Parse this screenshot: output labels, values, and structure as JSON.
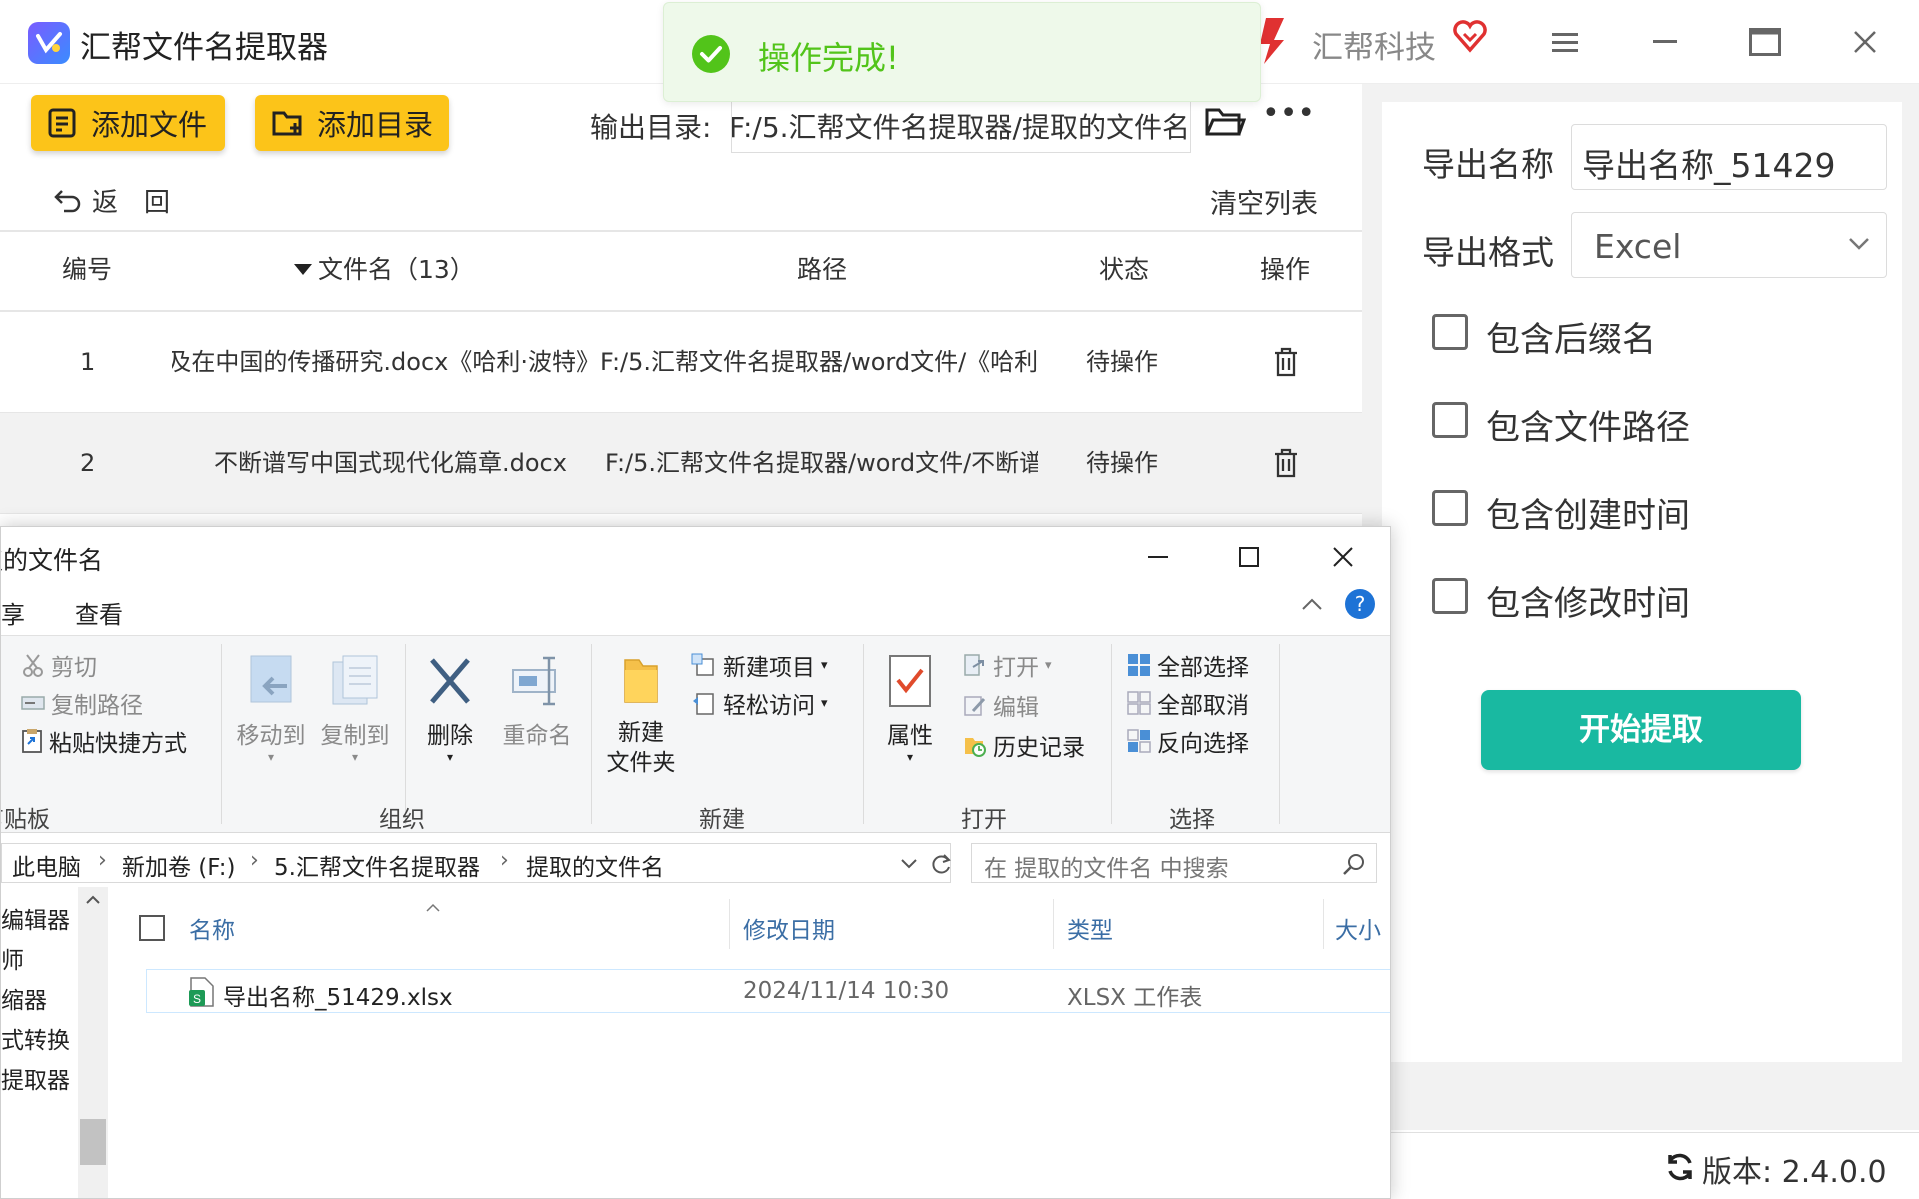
{
  "app": {
    "title": "汇帮文件名提取器",
    "brand": "汇帮科技"
  },
  "toast": {
    "message": "操作完成!"
  },
  "toolbar": {
    "add_file": "添加文件",
    "add_dir": "添加目录",
    "output_label": "输出目录:",
    "output_path": "F:/5.汇帮文件名提取器/提取的文件名",
    "more": "•••"
  },
  "nav": {
    "back": "返　回",
    "clear": "清空列表"
  },
  "table": {
    "headers": {
      "index": "编号",
      "name": "文件名（13）",
      "path": "路径",
      "status": "状态",
      "action": "操作"
    },
    "rows": [
      {
        "index": "1",
        "name": "《哈利·波特》系列小说叙事特征及在中国的传播研究.docx",
        "path": "F:/5.汇帮文件名提取器/word文件/《哈利",
        "status": "待操作"
      },
      {
        "index": "2",
        "name": "不断谱写中国式现代化篇章.docx",
        "path": "F:/5.汇帮文件名提取器/word文件/不断谱",
        "status": "待操作"
      }
    ]
  },
  "settings": {
    "export_name_label": "导出名称",
    "export_name_value": "导出名称_51429",
    "export_format_label": "导出格式",
    "export_format_value": "Excel",
    "options": [
      {
        "label": "包含后缀名",
        "checked": false
      },
      {
        "label": "包含文件路径",
        "checked": false
      },
      {
        "label": "包含创建时间",
        "checked": false
      },
      {
        "label": "包含修改时间",
        "checked": false
      }
    ],
    "start": "开始提取",
    "version": "版本:  2.4.0.0"
  },
  "explorer": {
    "title": "提取的文件名",
    "tabs": {
      "share": "共享",
      "view": "查看"
    },
    "ribbon": {
      "cut": "剪切",
      "copy_path": "复制路径",
      "paste_shortcut": "粘贴快捷方式",
      "clipboard_group": "剪贴板",
      "move_to": "移动到",
      "copy_to": "复制到",
      "delete": "删除",
      "rename": "重命名",
      "organize_group": "组织",
      "new_folder_line1": "新建",
      "new_folder_line2": "文件夹",
      "new_item": "新建项目",
      "easy_access": "轻松访问",
      "new_group": "新建",
      "properties": "属性",
      "open": "打开",
      "edit": "编辑",
      "history": "历史记录",
      "open_group": "打开",
      "select_all": "全部选择",
      "select_none": "全部取消",
      "invert_selection": "反向选择",
      "select_group": "选择"
    },
    "address": [
      "此电脑",
      "新加卷 (F:)",
      "5.汇帮文件名提取器",
      "提取的文件名"
    ],
    "search_placeholder": "在 提取的文件名 中搜索",
    "nav_items": [
      "编辑器",
      "师",
      "缩器",
      "式转换",
      "提取器"
    ],
    "columns": {
      "name": "名称",
      "modified": "修改日期",
      "type": "类型",
      "size": "大小"
    },
    "files": [
      {
        "name": "导出名称_51429.xlsx",
        "modified": "2024/11/14 10:30",
        "type": "XLSX 工作表"
      }
    ]
  },
  "colors": {
    "accent_yellow": "#fcc419",
    "start_button": "#19b9a1",
    "toast_green": "#52c41a"
  }
}
